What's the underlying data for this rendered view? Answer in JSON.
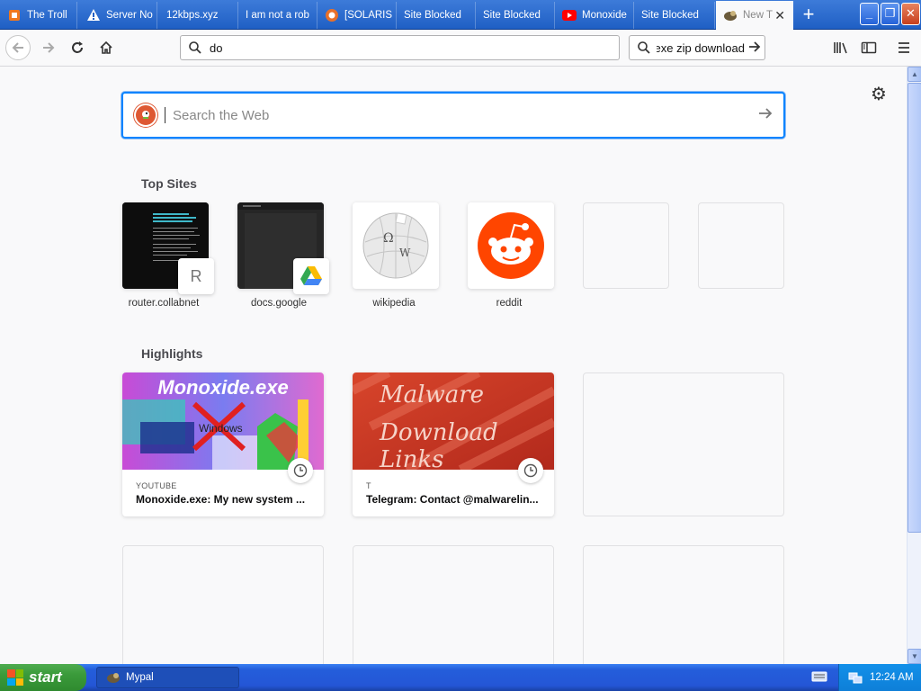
{
  "tabs": [
    {
      "label": "The Troll",
      "favicon": "orange-square-icon"
    },
    {
      "label": "Server No",
      "favicon": "warning-icon"
    },
    {
      "label": "12kbps.xyz",
      "favicon": "none"
    },
    {
      "label": "I am not a rob",
      "favicon": "none"
    },
    {
      "label": "[SOLARIS",
      "favicon": "orange-circle-icon"
    },
    {
      "label": "Site Blocked",
      "favicon": "none"
    },
    {
      "label": "Site Blocked",
      "favicon": "none"
    },
    {
      "label": "Monoxide",
      "favicon": "youtube-icon"
    },
    {
      "label": "Site Blocked",
      "favicon": "none"
    },
    {
      "label": "New T",
      "favicon": "palemoon-icon",
      "active": true
    }
  ],
  "toolbar": {
    "url_text": "do",
    "search_text": "exe zip download"
  },
  "newtab": {
    "search_placeholder": "Search the Web",
    "top_sites_title": "Top Sites",
    "highlights_title": "Highlights",
    "top_sites": [
      {
        "label": "router.collabnet",
        "badge": "R"
      },
      {
        "label": "docs.google",
        "badge": "google-drive-icon"
      },
      {
        "label": "wikipedia"
      },
      {
        "label": "reddit"
      }
    ],
    "highlights": [
      {
        "source": "YOUTUBE",
        "title": "Monoxide.exe: My new system ...",
        "thumb_text": "Monoxide.exe",
        "thumb_sub": "Windows"
      },
      {
        "source": "T",
        "title": "Telegram: Contact @malwarelin...",
        "thumb_line1": "Malware",
        "thumb_line2": "Download Links"
      }
    ]
  },
  "taskbar": {
    "start_label": "start",
    "task_label": "Mypal",
    "clock": "12:24 AM"
  },
  "colors": {
    "accent": "#0a84ff",
    "ddg": "#de5833",
    "reddit": "#ff4500",
    "xp_blue": "#245edb",
    "xp_green": "#3a9a3a"
  }
}
